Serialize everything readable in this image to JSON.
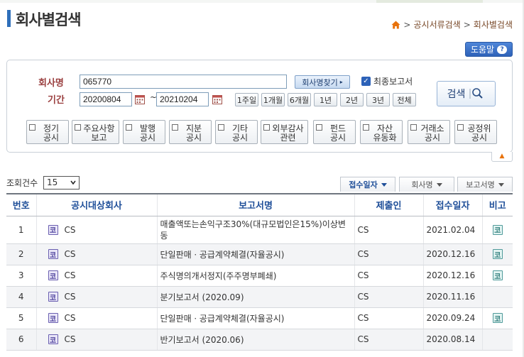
{
  "page": {
    "title": "회사별검색"
  },
  "breadcrumb": {
    "items": [
      "공시서류검색",
      "회사별검색"
    ],
    "sep": ">"
  },
  "help": {
    "label": "도움말",
    "icon": "?"
  },
  "search": {
    "company_label": "회사명",
    "company_value": "065770",
    "find_company_label": "회사명찾기",
    "final_report_checked": true,
    "final_report_label": "최종보고서",
    "period_label": "기간",
    "start_date": "20200804",
    "end_date": "20210204",
    "dash": "~",
    "ranges": [
      "1주일",
      "1개월",
      "6개월",
      "1년",
      "2년",
      "3년",
      "전체"
    ],
    "search_label": "검색"
  },
  "categories": [
    {
      "l1": "정기",
      "l2": "공시"
    },
    {
      "l1": "주요사항",
      "l2": "보고"
    },
    {
      "l1": "발행",
      "l2": "공시"
    },
    {
      "l1": "지분",
      "l2": "공시"
    },
    {
      "l1": "기타",
      "l2": "공시"
    },
    {
      "l1": "외부감사",
      "l2": "관련"
    },
    {
      "l1": "펀드",
      "l2": "공시"
    },
    {
      "l1": "자산",
      "l2": "유동화"
    },
    {
      "l1": "거래소",
      "l2": "공시"
    },
    {
      "l1": "공정위",
      "l2": "공시"
    }
  ],
  "results": {
    "count_label": "조회건수",
    "count_value": "15",
    "sort_buttons": [
      "접수일자",
      "회사명",
      "보고서명"
    ],
    "columns": [
      "번호",
      "공시대상회사",
      "보고서명",
      "제출인",
      "접수일자",
      "비고"
    ],
    "rows": [
      {
        "no": "1",
        "badge": "코",
        "company": "CS",
        "report": "매출액또는손익구조30%(대규모법인은15%)이상변동",
        "submitter": "CS",
        "date": "2021.02.04",
        "note": "코"
      },
      {
        "no": "2",
        "badge": "코",
        "company": "CS",
        "report": "단일판매ㆍ공급계약체결(자율공시)",
        "submitter": "CS",
        "date": "2020.12.16",
        "note": "코"
      },
      {
        "no": "3",
        "badge": "코",
        "company": "CS",
        "report": "주식명의개서정지(주주명부폐쇄)",
        "submitter": "CS",
        "date": "2020.12.16",
        "note": "코"
      },
      {
        "no": "4",
        "badge": "코",
        "company": "CS",
        "report": "분기보고서 (2020.09)",
        "submitter": "CS",
        "date": "2020.11.16",
        "note": ""
      },
      {
        "no": "5",
        "badge": "코",
        "company": "CS",
        "report": "단일판매ㆍ공급계약체결(자율공시)",
        "submitter": "CS",
        "date": "2020.09.24",
        "note": "코"
      },
      {
        "no": "6",
        "badge": "코",
        "company": "CS",
        "report": "반기보고서 (2020.06)",
        "submitter": "CS",
        "date": "2020.08.14",
        "note": ""
      }
    ]
  },
  "colors": {
    "accent": "#2f6fba",
    "label": "#9a3f3f",
    "header": "#1f4f99",
    "breadcrumb": "#7a4a2a"
  }
}
